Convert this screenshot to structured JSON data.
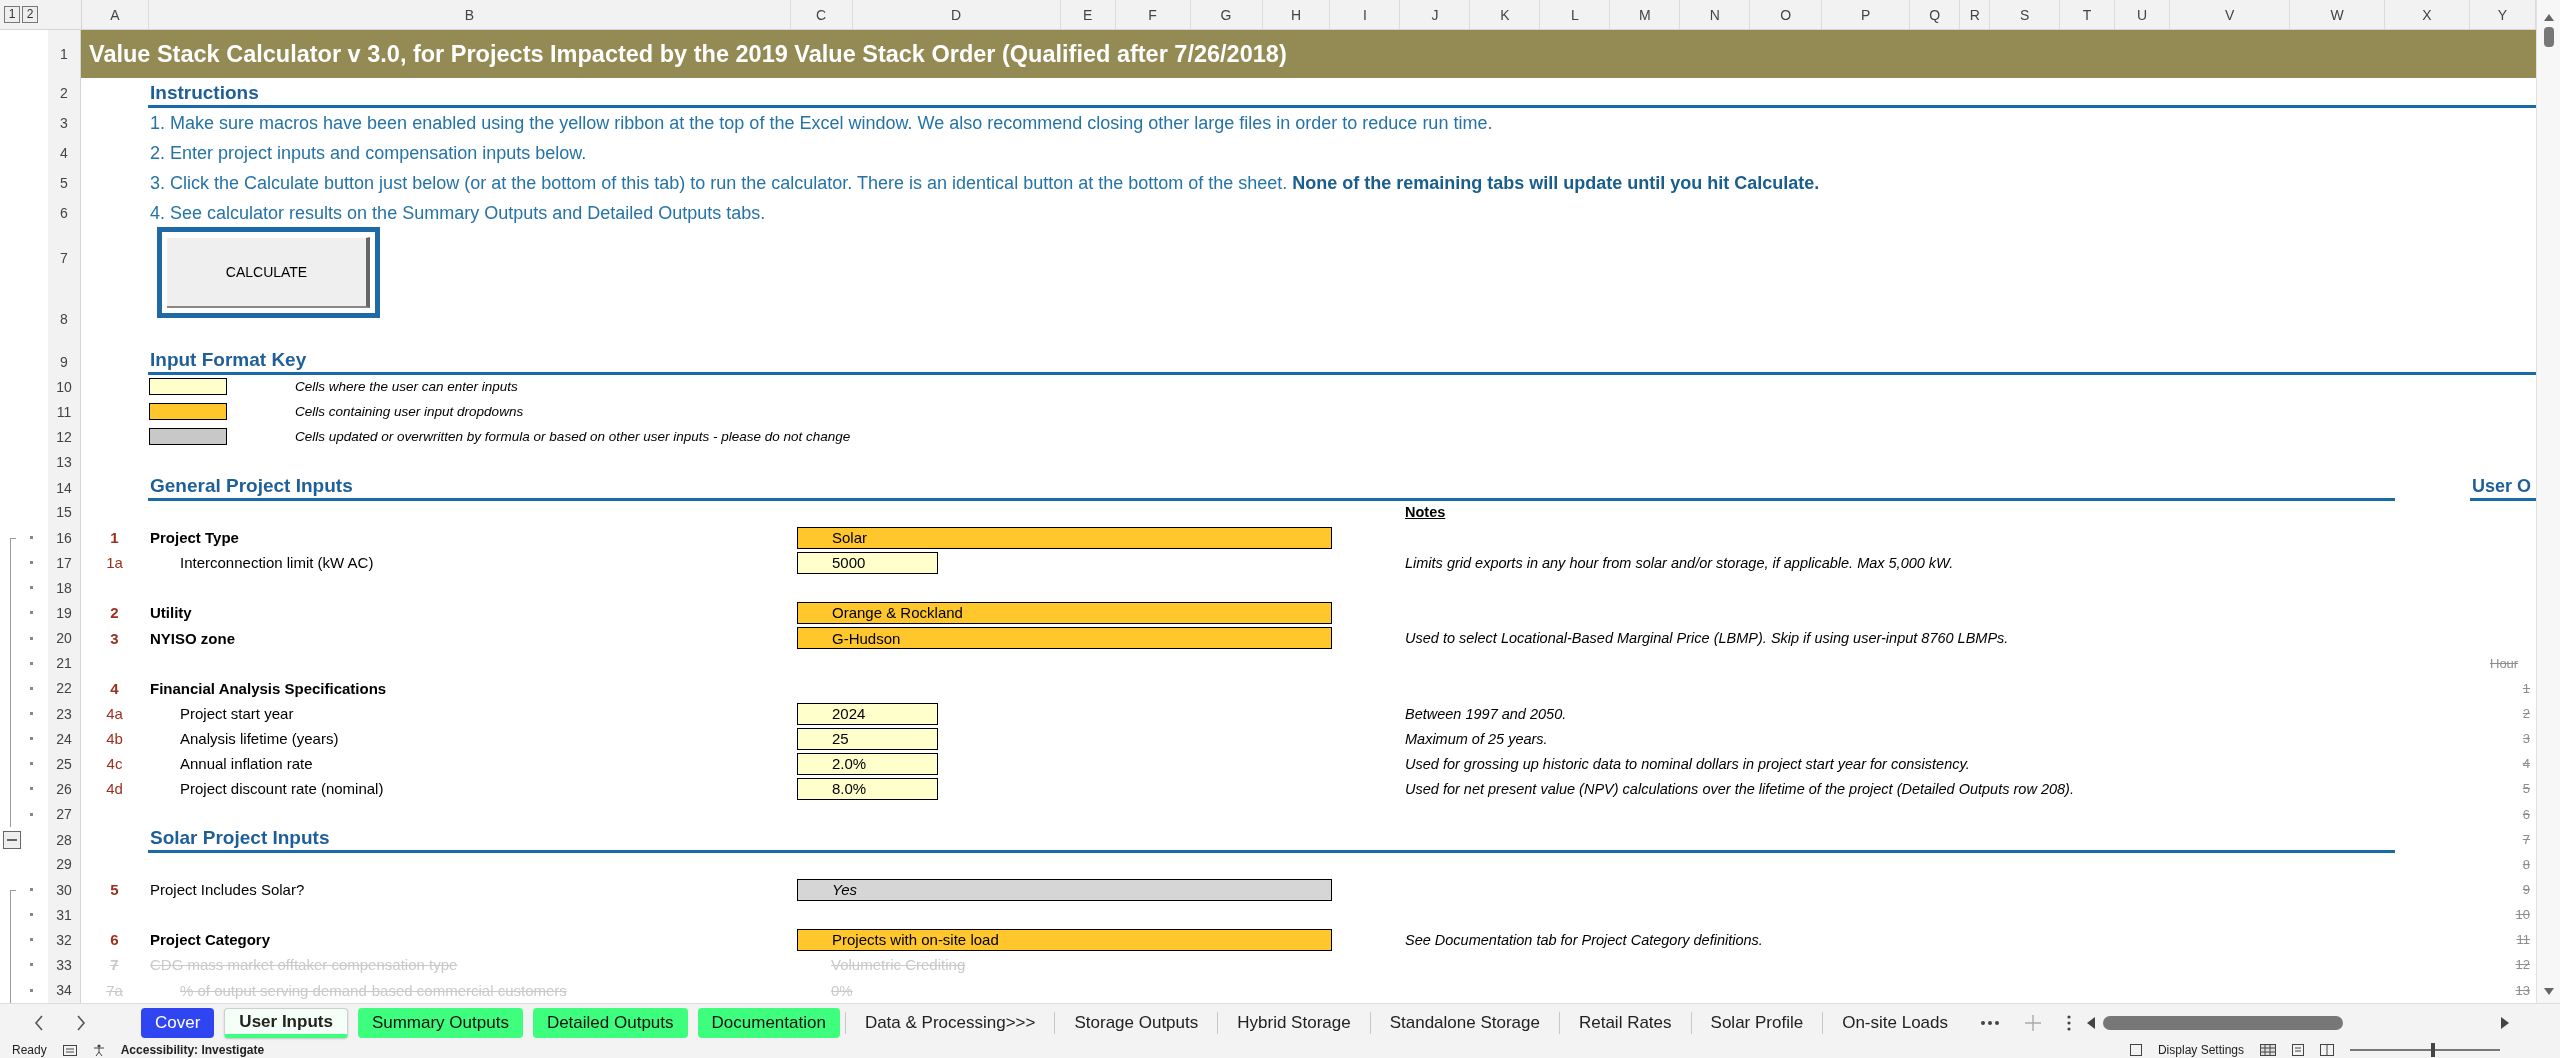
{
  "sheet": {
    "outline_levels": [
      "1",
      "2"
    ],
    "columns": [
      "A",
      "B",
      "C",
      "D",
      "E",
      "F",
      "G",
      "H",
      "I",
      "J",
      "K",
      "L",
      "M",
      "N",
      "O",
      "P",
      "Q",
      "R",
      "S",
      "T",
      "U",
      "V",
      "W",
      "X",
      "Y"
    ],
    "rows": [
      {
        "row": "1",
        "kind": "title",
        "text": "Value Stack Calculator v 3.0, for Projects Impacted by the 2019 Value Stack Order (Qualified after 7/26/2018)"
      },
      {
        "row": "2",
        "kind": "heading",
        "text": "Instructions"
      },
      {
        "row": "3",
        "kind": "instruction",
        "text": "1. Make sure macros have been enabled using the yellow ribbon at the top of the Excel window. We also recommend closing other large files in order to reduce run time."
      },
      {
        "row": "4",
        "kind": "instruction",
        "text": "2. Enter project inputs and compensation inputs below."
      },
      {
        "row": "5",
        "kind": "instruction",
        "text": "3. Click the Calculate button just below (or at the bottom of this tab) to run the calculator. There is an identical button at the bottom of the sheet. **None of the remaining tabs will update until you hit Calculate.**"
      },
      {
        "row": "6",
        "kind": "instruction",
        "text": "4. See calculator results on the Summary Outputs and Detailed Outputs tabs."
      },
      {
        "row": "7",
        "kind": "blank"
      },
      {
        "row": "8",
        "kind": "blank"
      },
      {
        "row": "9",
        "kind": "heading",
        "text": "Input Format Key"
      },
      {
        "row": "10",
        "kind": "key",
        "color": "#ffffcc",
        "text": "Cells where the user can enter inputs"
      },
      {
        "row": "11",
        "kind": "key",
        "color": "#ffc72c",
        "text": "Cells containing user input dropdowns"
      },
      {
        "row": "12",
        "kind": "key",
        "color": "#c8c8c8",
        "text": "Cells updated or overwritten by formula or based on other user inputs - please do not change"
      },
      {
        "row": "13",
        "kind": "blank"
      },
      {
        "row": "14",
        "kind": "section",
        "text": "General Project Inputs",
        "side": "User O"
      },
      {
        "row": "15",
        "kind": "blank",
        "note_title": "Notes"
      },
      {
        "row": "16",
        "kind": "item",
        "outline_mark": {
          "kind": "bracket"
        },
        "number": "1",
        "label": "Project Type",
        "bold": true,
        "disabled": false,
        "value": {
          "kind": "dropdown",
          "text": "Solar"
        }
      },
      {
        "row": "17",
        "kind": "subitem",
        "outline_mark": {
          "kind": "dot"
        },
        "number": "1a",
        "label": "Interconnection limit (kW AC)",
        "bold": false,
        "disabled": false,
        "value": {
          "kind": "input",
          "text": "5000"
        },
        "note": "Limits grid exports in any hour from solar and/or storage, if applicable. Max 5,000 kW."
      },
      {
        "row": "18",
        "kind": "blank",
        "outline_mark": {
          "kind": "dot"
        }
      },
      {
        "row": "19",
        "kind": "item",
        "outline_mark": {
          "kind": "dot"
        },
        "number": "2",
        "label": "Utility",
        "bold": true,
        "disabled": false,
        "value": {
          "kind": "dropdown",
          "text": "Orange & Rockland"
        }
      },
      {
        "row": "20",
        "kind": "item",
        "outline_mark": {
          "kind": "dot"
        },
        "number": "3",
        "label": "NYISO zone",
        "bold": true,
        "disabled": false,
        "value": {
          "kind": "dropdown",
          "text": "G-Hudson"
        },
        "note": "Used to select Locational-Based Marginal Price (LBMP). Skip if using user-input 8760 LBMPs."
      },
      {
        "row": "21",
        "kind": "blank",
        "outline_mark": {
          "kind": "dot"
        },
        "side": "Hour"
      },
      {
        "row": "22",
        "kind": "item",
        "outline_mark": {
          "kind": "dot"
        },
        "number": "4",
        "label": "Financial Analysis Specifications",
        "bold": true,
        "disabled": false,
        "side": "1"
      },
      {
        "row": "23",
        "kind": "subitem",
        "outline_mark": {
          "kind": "dot"
        },
        "number": "4a",
        "label": "Project start year",
        "bold": false,
        "disabled": false,
        "value": {
          "kind": "input",
          "text": "2024"
        },
        "note": "Between 1997 and 2050.",
        "side": "2"
      },
      {
        "row": "24",
        "kind": "subitem",
        "outline_mark": {
          "kind": "dot"
        },
        "number": "4b",
        "label": "Analysis lifetime (years)",
        "bold": false,
        "disabled": false,
        "value": {
          "kind": "input",
          "text": "25"
        },
        "note": "Maximum of 25 years.",
        "side": "3"
      },
      {
        "row": "25",
        "kind": "subitem",
        "outline_mark": {
          "kind": "dot"
        },
        "number": "4c",
        "label": "Annual inflation rate",
        "bold": false,
        "disabled": false,
        "value": {
          "kind": "input",
          "text": "2.0%"
        },
        "note": "Used for grossing up historic data to nominal dollars in project start year for consistency.",
        "side": "4"
      },
      {
        "row": "26",
        "kind": "subitem",
        "outline_mark": {
          "kind": "dot"
        },
        "number": "4d",
        "label": "Project discount rate (nominal)",
        "bold": false,
        "disabled": false,
        "value": {
          "kind": "input",
          "text": "8.0%"
        },
        "note": "Used for net present value (NPV) calculations over the lifetime of the project (Detailed Outputs row 208).",
        "side": "5"
      },
      {
        "row": "27",
        "kind": "blank",
        "outline_mark": {
          "kind": "dot"
        },
        "side": "6"
      },
      {
        "row": "28",
        "kind": "section",
        "outline_mark": {
          "kind": "minus"
        },
        "text": "Solar Project Inputs",
        "side": "7"
      },
      {
        "row": "29",
        "kind": "blank",
        "side": "8"
      },
      {
        "row": "30",
        "kind": "item",
        "outline_mark": {
          "kind": "bracket"
        },
        "number": "5",
        "label": "Project Includes Solar?",
        "bold": false,
        "disabled": false,
        "value": {
          "kind": "formula",
          "text": "Yes"
        },
        "side": "9"
      },
      {
        "row": "31",
        "kind": "blank",
        "outline_mark": {
          "kind": "dot"
        },
        "side": "10"
      },
      {
        "row": "32",
        "kind": "item",
        "outline_mark": {
          "kind": "dot"
        },
        "number": "6",
        "label": "Project Category",
        "bold": true,
        "disabled": false,
        "value": {
          "kind": "dropdown",
          "text": "Projects with on-site load"
        },
        "note": "See Documentation tab for Project Category definitions.",
        "side": "11"
      },
      {
        "row": "33",
        "kind": "item",
        "outline_mark": {
          "kind": "dot"
        },
        "number": "7",
        "label": "CDG mass market offtaker compensation type",
        "bold": false,
        "disabled": true,
        "value": {
          "text": "Volumetric Crediting"
        },
        "side": "12"
      },
      {
        "row": "34",
        "kind": "subitem",
        "outline_mark": {
          "kind": "dot"
        },
        "number": "7a",
        "label": "% of output serving demand-based commercial customers",
        "bold": false,
        "disabled": true,
        "value": {
          "text": "0%"
        },
        "side": "13"
      }
    ]
  },
  "calculate_button": {
    "label": "CALCULATE"
  },
  "sheet_tabs": [
    {
      "label": "Cover",
      "color": "#2f45f2",
      "selected": false
    },
    {
      "label": "User Inputs",
      "color": "#3dff7d",
      "selected": true
    },
    {
      "label": "Summary Outputs",
      "color": "#3dff7d",
      "selected": false
    },
    {
      "label": "Detailed Outputs",
      "color": "#3dff7d",
      "selected": false
    },
    {
      "label": "Documentation",
      "color": "#3dff7d",
      "selected": false
    },
    {
      "label": "Data & Processing>>>",
      "selected": false
    },
    {
      "label": "Storage Outputs",
      "selected": false
    },
    {
      "label": "Hybrid Storage",
      "selected": false
    },
    {
      "label": "Standalone Storage",
      "selected": false
    },
    {
      "label": "Retail Rates",
      "selected": false
    },
    {
      "label": "Solar Profile",
      "selected": false
    },
    {
      "label": "On-site Loads",
      "selected": false
    }
  ],
  "status_bar": {
    "status": "Ready",
    "accessibility": "Accessibility: Investigate",
    "display_settings": "Display Settings",
    "zoom": {
      "level": 0.55
    }
  }
}
